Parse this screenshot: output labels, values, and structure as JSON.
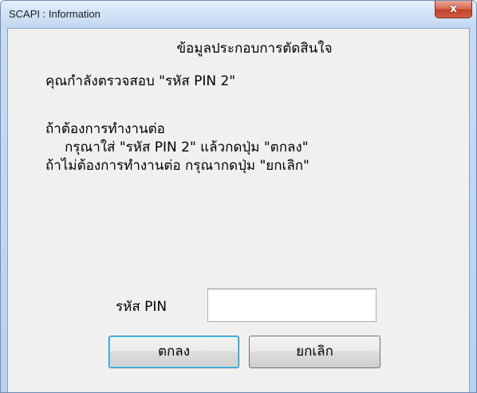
{
  "window": {
    "title": "SCAPI : Information",
    "close_glyph": "x"
  },
  "dialog": {
    "heading": "ข้อมูลประกอบการตัดสินใจ",
    "line1": "คุณกำลังตรวจสอบ \"รหัส PIN 2\"",
    "line2": "ถ้าต้องการทำงานต่อ",
    "line3": "กรุณาใส่ \"รหัส PIN 2\" แล้วกดปุ่ม \"ตกลง\"",
    "line4": "ถ้าไม่ต้องการทำงานต่อ กรุณากดปุ่ม \"ยกเลิก\"",
    "pin_label": "รหัส PIN",
    "pin_value": "",
    "ok_label": "ตกลง",
    "cancel_label": "ยกเลิก"
  },
  "icons": {
    "close": "close-icon"
  },
  "colors": {
    "close_button": "#c4412a",
    "client_bg": "#f0f0f0",
    "default_button_border": "#3c7fb1"
  }
}
